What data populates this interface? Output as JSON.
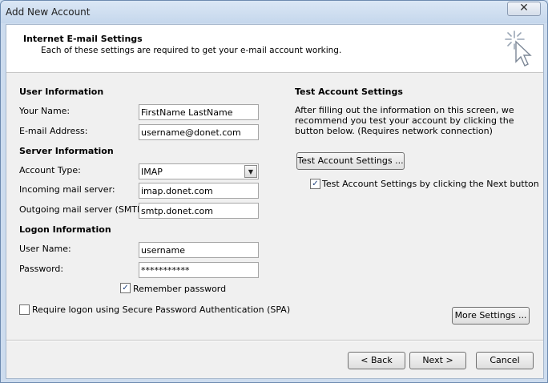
{
  "window": {
    "title": "Add New Account",
    "close_glyph": "✕"
  },
  "header": {
    "title": "Internet E-mail Settings",
    "subtitle": "Each of these settings are required to get your e-mail account working.",
    "icon": "wizard-cursor-icon"
  },
  "user_info": {
    "heading": "User Information",
    "name_label": "Your Name:",
    "name_value": "FirstName LastName",
    "email_label": "E-mail Address:",
    "email_value": "username@donet.com"
  },
  "server_info": {
    "heading": "Server Information",
    "account_type_label": "Account Type:",
    "account_type_value": "IMAP",
    "incoming_label": "Incoming mail server:",
    "incoming_value": "imap.donet.com",
    "outgoing_label": "Outgoing mail server (SMTP):",
    "outgoing_value": "smtp.donet.com"
  },
  "logon_info": {
    "heading": "Logon Information",
    "username_label": "User Name:",
    "username_value": "username",
    "password_label": "Password:",
    "password_value": "***********",
    "remember_label": "Remember password",
    "remember_checked": true,
    "spa_label": "Require logon using Secure Password Authentication (SPA)",
    "spa_checked": false
  },
  "test_settings": {
    "heading": "Test Account Settings",
    "description": "After filling out the information on this screen, we recommend you test your account by clicking the button below. (Requires network connection)",
    "test_button": "Test Account Settings ...",
    "next_test_label": "Test Account Settings by clicking the Next button",
    "next_test_checked": true,
    "more_settings_button": "More Settings ..."
  },
  "footer": {
    "back_button": "< Back",
    "next_button": "Next >",
    "cancel_button": "Cancel"
  },
  "glyphs": {
    "check": "✓",
    "dropdown_arrow": "▼"
  }
}
